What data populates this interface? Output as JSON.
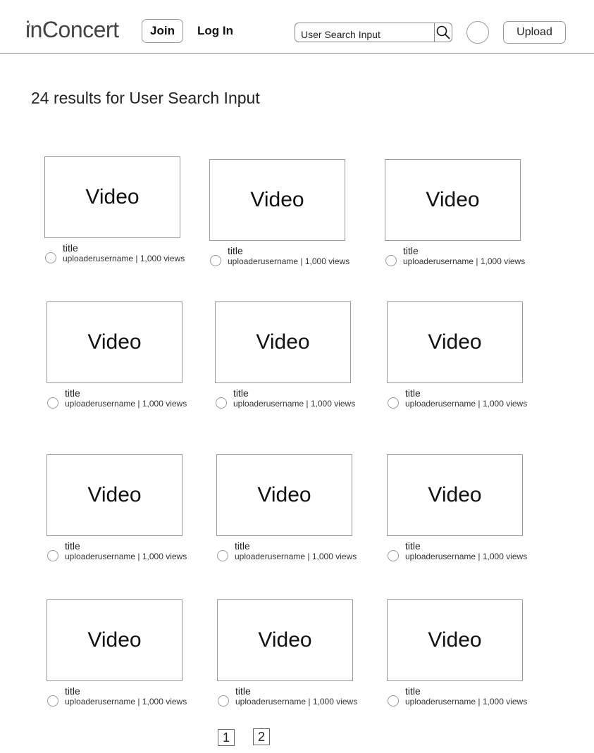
{
  "header": {
    "logo": "inConcert",
    "logo_note": "♪",
    "join_label": "Join",
    "login_label": "Log In",
    "search_value": "User Search Input",
    "upload_label": "Upload"
  },
  "results": {
    "heading": "24 results for User Search Input"
  },
  "videos": [
    {
      "thumb": "Video",
      "title": "title",
      "uploader": "uploaderusername",
      "views": "1,000 views",
      "meta": "uploaderusername | 1,000 views"
    },
    {
      "thumb": "Video",
      "title": "title",
      "uploader": "uploaderusername",
      "views": "1,000 views",
      "meta": "uploaderusername | 1,000 views"
    },
    {
      "thumb": "Video",
      "title": "title",
      "uploader": "uploaderusername",
      "views": "1,000 views",
      "meta": "uploaderusername | 1,000 views"
    },
    {
      "thumb": "Video",
      "title": "title",
      "uploader": "uploaderusername",
      "views": "1,000 views",
      "meta": "uploaderusername | 1,000 views"
    },
    {
      "thumb": "Video",
      "title": "title",
      "uploader": "uploaderusername",
      "views": "1,000 views",
      "meta": "uploaderusername | 1,000 views"
    },
    {
      "thumb": "Video",
      "title": "title",
      "uploader": "uploaderusername",
      "views": "1,000 views",
      "meta": "uploaderusername | 1,000 views"
    },
    {
      "thumb": "Video",
      "title": "title",
      "uploader": "uploaderusername",
      "views": "1,000 views",
      "meta": "uploaderusername | 1,000 views"
    },
    {
      "thumb": "Video",
      "title": "title",
      "uploader": "uploaderusername",
      "views": "1,000 views",
      "meta": "uploaderusername | 1,000 views"
    },
    {
      "thumb": "Video",
      "title": "title",
      "uploader": "uploaderusername",
      "views": "1,000 views",
      "meta": "uploaderusername | 1,000 views"
    },
    {
      "thumb": "Video",
      "title": "title",
      "uploader": "uploaderusername",
      "views": "1,000 views",
      "meta": "uploaderusername | 1,000 views"
    },
    {
      "thumb": "Video",
      "title": "title",
      "uploader": "uploaderusername",
      "views": "1,000 views",
      "meta": "uploaderusername | 1,000 views"
    },
    {
      "thumb": "Video",
      "title": "title",
      "uploader": "uploaderusername",
      "views": "1,000 views",
      "meta": "uploaderusername | 1,000 views"
    }
  ],
  "pagination": {
    "pages": [
      "1",
      "2"
    ]
  },
  "colors": {
    "border": "#9a9a9a",
    "text": "#111111",
    "background": "#ffffff"
  }
}
